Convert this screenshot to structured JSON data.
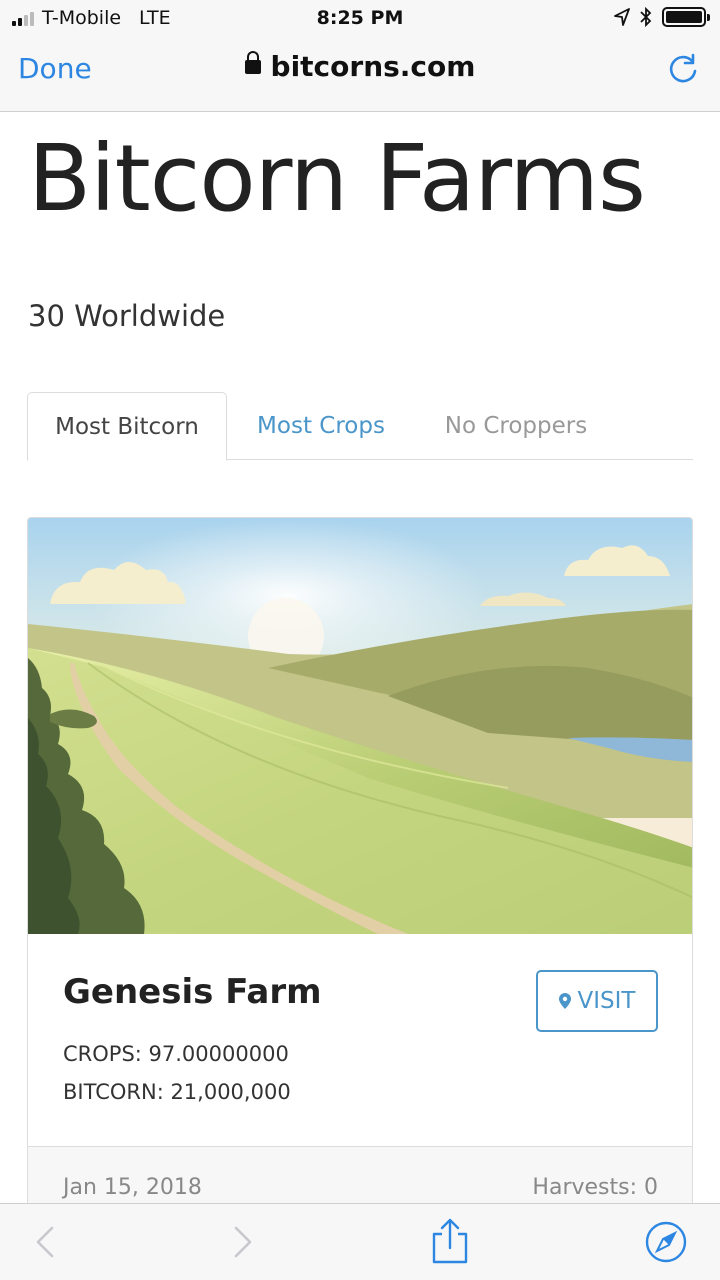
{
  "status_bar": {
    "carrier": "T-Mobile",
    "network": "LTE",
    "time": "8:25 PM"
  },
  "nav_bar": {
    "done_label": "Done",
    "url": "bitcorns.com"
  },
  "page": {
    "title": "Bitcorn Farms",
    "subtitle": "30 Worldwide",
    "tabs": [
      {
        "label": "Most Bitcorn",
        "active": true
      },
      {
        "label": "Most Crops",
        "active": false
      },
      {
        "label": "No Croppers",
        "active": false
      }
    ],
    "card": {
      "name": "Genesis Farm",
      "crops": "CROPS: 97.00000000",
      "bitcorn": "BITCORN: 21,000,000",
      "visit_label": "VISIT",
      "date": "Jan 15, 2018",
      "harvests": "Harvests: 0"
    }
  },
  "colors": {
    "link_blue": "#4a95c9",
    "ios_blue": "#2d87e2"
  },
  "icons": [
    "lock-icon",
    "reload-icon",
    "map-pin-icon",
    "back-icon",
    "forward-icon",
    "share-icon",
    "compass-icon"
  ]
}
